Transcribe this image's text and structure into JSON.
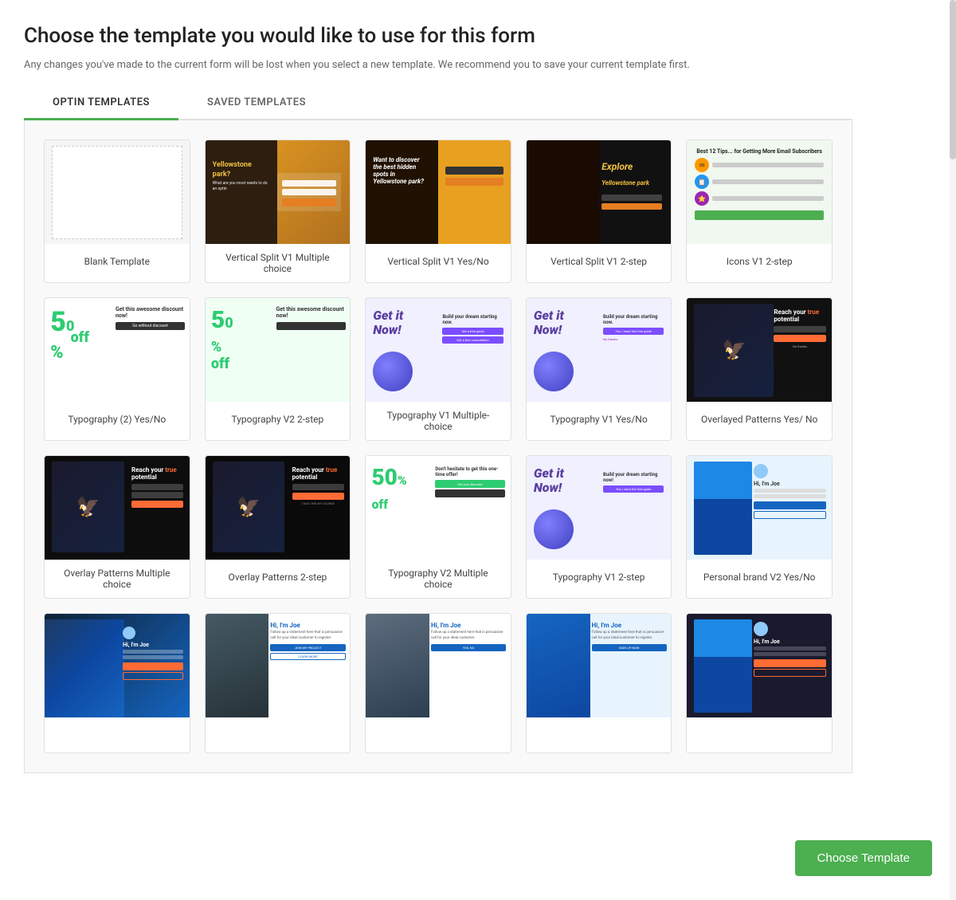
{
  "page": {
    "title": "Choose the template you would like to use for this form",
    "subtitle": "Any changes you've made to the current form will be lost when you select a new template. We recommend you to save your current template first.",
    "tabs": [
      {
        "id": "optin",
        "label": "OPTIN TEMPLATES",
        "active": true
      },
      {
        "id": "saved",
        "label": "SAVED TEMPLATES",
        "active": false
      }
    ],
    "choose_button": "Choose Template"
  },
  "templates": {
    "row1": [
      {
        "id": "blank",
        "label": "Blank Template"
      },
      {
        "id": "vert-split-v1-mc",
        "label": "Vertical Split V1 Multiple choice"
      },
      {
        "id": "vert-split-v1-yesno",
        "label": "Vertical Split V1 Yes/No"
      },
      {
        "id": "vert-split-v1-2step",
        "label": "Vertical Split V1 2-step"
      },
      {
        "id": "icons-v1-2step",
        "label": "Icons V1 2-step"
      }
    ],
    "row2": [
      {
        "id": "typo2-yesno",
        "label": "Typography (2) Yes/No"
      },
      {
        "id": "typo-v2-2step",
        "label": "Typography V2 2-step"
      },
      {
        "id": "typo-v1-mc",
        "label": "Typography V1 Multiple-choice"
      },
      {
        "id": "typo-v1-yesno",
        "label": "Typography V1 Yes/No"
      },
      {
        "id": "overlayed-yesno",
        "label": "Overlayed Patterns Yes/ No"
      }
    ],
    "row3": [
      {
        "id": "overlay-mc",
        "label": "Overlay Patterns Multiple choice"
      },
      {
        "id": "overlay-2step",
        "label": "Overlay Patterns 2-step"
      },
      {
        "id": "typo-v2-mc",
        "label": "Typography V2 Multiple choice"
      },
      {
        "id": "typo-v1-2step",
        "label": "Typography V1 2-step"
      },
      {
        "id": "personal-brand-v2-yesno",
        "label": "Personal brand V2 Yes/No"
      }
    ],
    "row4": [
      {
        "id": "personal-brand-v2b",
        "label": ""
      },
      {
        "id": "personal-brand-joe1",
        "label": ""
      },
      {
        "id": "personal-brand-joe2",
        "label": ""
      },
      {
        "id": "personal-brand-joe3",
        "label": ""
      },
      {
        "id": "personal-brand-dark",
        "label": ""
      }
    ]
  },
  "colors": {
    "green_accent": "#4caf50",
    "tab_active_border": "#4caf50",
    "choose_btn_bg": "#4caf50"
  }
}
